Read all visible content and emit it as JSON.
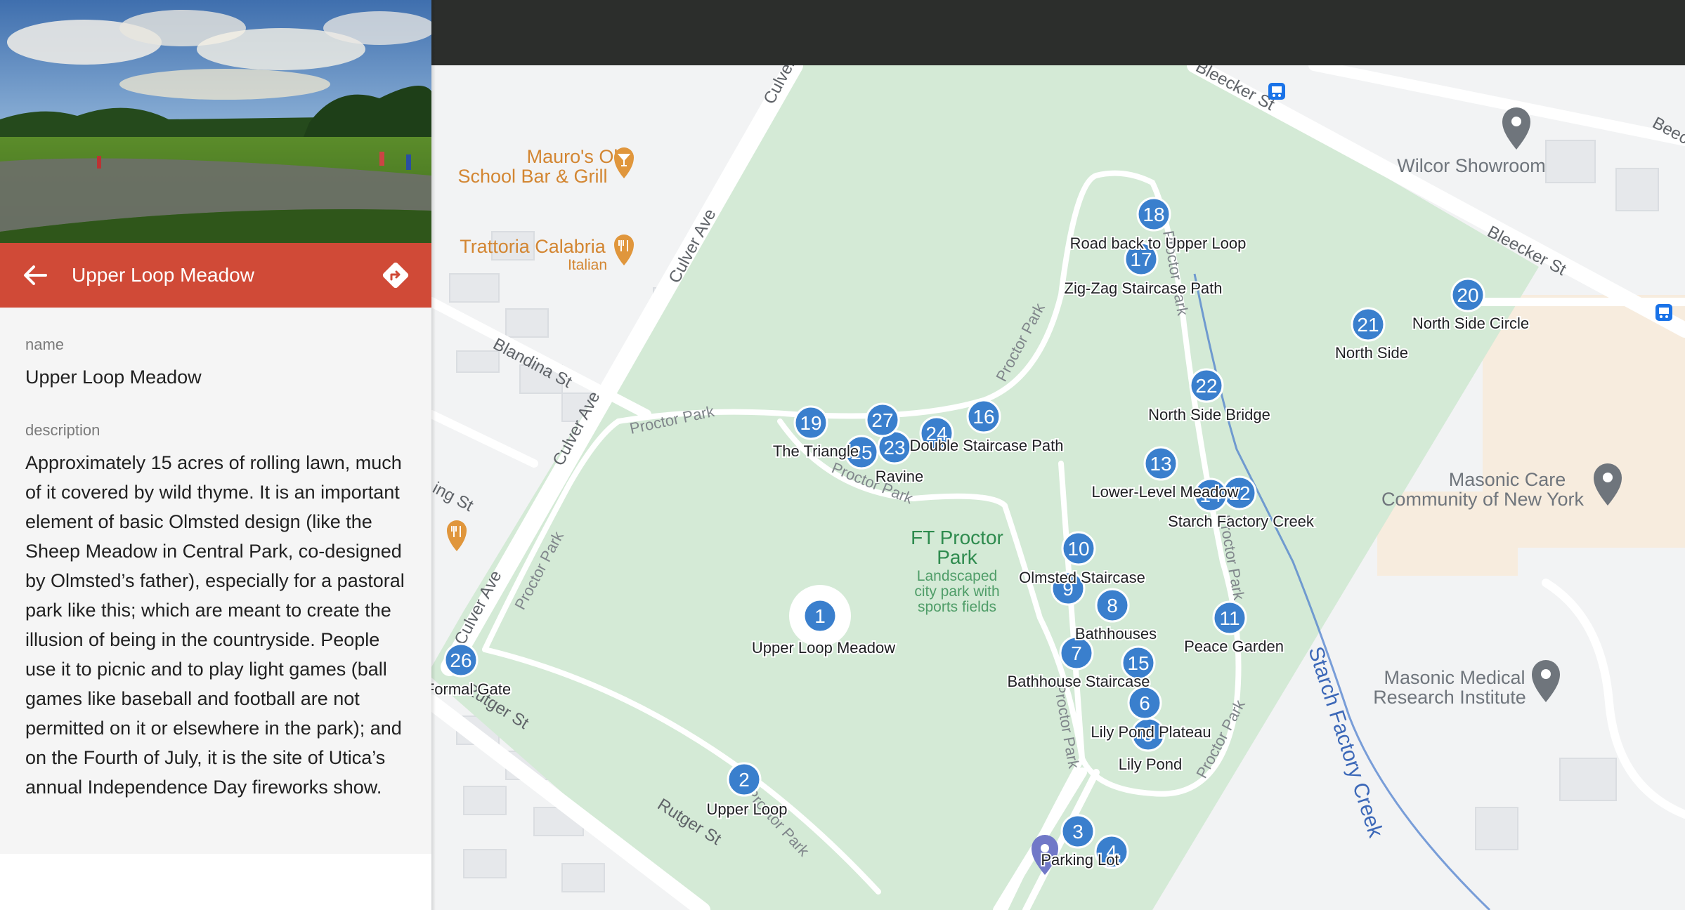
{
  "place": {
    "name": "Upper Loop Meadow",
    "fields": {
      "name_label": "name",
      "name_value": "Upper Loop Meadow",
      "description_label": "description",
      "description_value": "Approximately 15 acres of rolling lawn, much of it covered by wild thyme. It is an important element of basic Olmsted design (like the Sheep Meadow in Central Park, co-designed by Olmsted’s father), especially for a pastoral park like this; which are meant to create the illusion of being in the countryside. People use it to picnic and to play light games (ball games like baseball and football are not permitted on it or elsewhere in the park); and on the Fourth of July, it is the site of Utica’s annual Independence Day fireworks show."
    },
    "header_color": "#d04a37"
  },
  "icons": {
    "back": "arrow-left-icon",
    "directions": "directions-icon",
    "restaurant": "fork-knife-icon",
    "bar": "cocktail-icon",
    "place": "map-pin-icon",
    "bus": "bus-icon"
  },
  "map": {
    "park_label": "FT Proctor Park",
    "park_sublabel": "Landscaped city park with sports fields",
    "streets": [
      "Culver Ave",
      "Culver Ave",
      "Culver Ave",
      "Culver Ave",
      "Blandina St",
      "Rutger St",
      "Rutger St",
      "Bleecker St",
      "Bleecker St",
      "Beec",
      "ing St"
    ],
    "paths": [
      "Proctor Park",
      "Proctor Park",
      "Proctor Park",
      "Proctor Park",
      "Proctor Park",
      "Proctor Park",
      "Proctor Park",
      "Proctor Park"
    ],
    "creek": "Starch Factory Creek",
    "pois": [
      {
        "id": "mauros",
        "name": "Mauro's Old School Bar & Grill",
        "line1": "Mauro's Old",
        "line2": "School Bar & Grill",
        "icon": "cocktail-icon"
      },
      {
        "id": "trattoria",
        "name": "Trattoria Calabria",
        "sub": "Italian",
        "icon": "fork-knife-icon"
      },
      {
        "id": "wilcor",
        "name": "Wilcor Showroom",
        "icon": "map-pin-icon"
      },
      {
        "id": "masonic-care",
        "line1": "Masonic Care",
        "line2": "Community of New York",
        "icon": "map-pin-icon"
      },
      {
        "id": "masonic-medical",
        "line1": "Masonic Medical",
        "line2": "Research Institute",
        "icon": "map-pin-icon"
      }
    ],
    "markers": [
      {
        "num": "1",
        "label": "Upper Loop Meadow",
        "selected": true
      },
      {
        "num": "2",
        "label": "Upper Loop"
      },
      {
        "num": "3",
        "label": ""
      },
      {
        "num": "4",
        "label": "Parking Lot"
      },
      {
        "num": "5",
        "label": "Lily Pond"
      },
      {
        "num": "6",
        "label": "Lily Pond Plateau"
      },
      {
        "num": "7",
        "label": "Bathhouse Staircase"
      },
      {
        "num": "8",
        "label": "Bathhouses"
      },
      {
        "num": "9",
        "label": ""
      },
      {
        "num": "10",
        "label": "Olmsted Staircase"
      },
      {
        "num": "11",
        "label": "Peace Garden"
      },
      {
        "num": "12",
        "label": "Starch Factory Creek"
      },
      {
        "num": "13",
        "label": ""
      },
      {
        "num": "14",
        "label": "Lower-Level Meadow"
      },
      {
        "num": "15",
        "label": ""
      },
      {
        "num": "16",
        "label": "Double Staircase Path"
      },
      {
        "num": "17",
        "label": "Zig-Zag Staircase Path"
      },
      {
        "num": "18",
        "label": "Road back to Upper Loop"
      },
      {
        "num": "19",
        "label": "The Triangle"
      },
      {
        "num": "20",
        "label": "North Side Circle"
      },
      {
        "num": "21",
        "label": "North Side"
      },
      {
        "num": "22",
        "label": "North Side Bridge"
      },
      {
        "num": "23",
        "label": "Ravine"
      },
      {
        "num": "24",
        "label": ""
      },
      {
        "num": "25",
        "label": ""
      },
      {
        "num": "26",
        "label": "Formal Gate"
      },
      {
        "num": "27",
        "label": ""
      }
    ],
    "colors": {
      "park": "#d4ead6",
      "marker": "#3a7fcd",
      "poi_orange": "#e0963c",
      "poi_gray": "#6f757c",
      "creek": "#4477cc"
    }
  }
}
